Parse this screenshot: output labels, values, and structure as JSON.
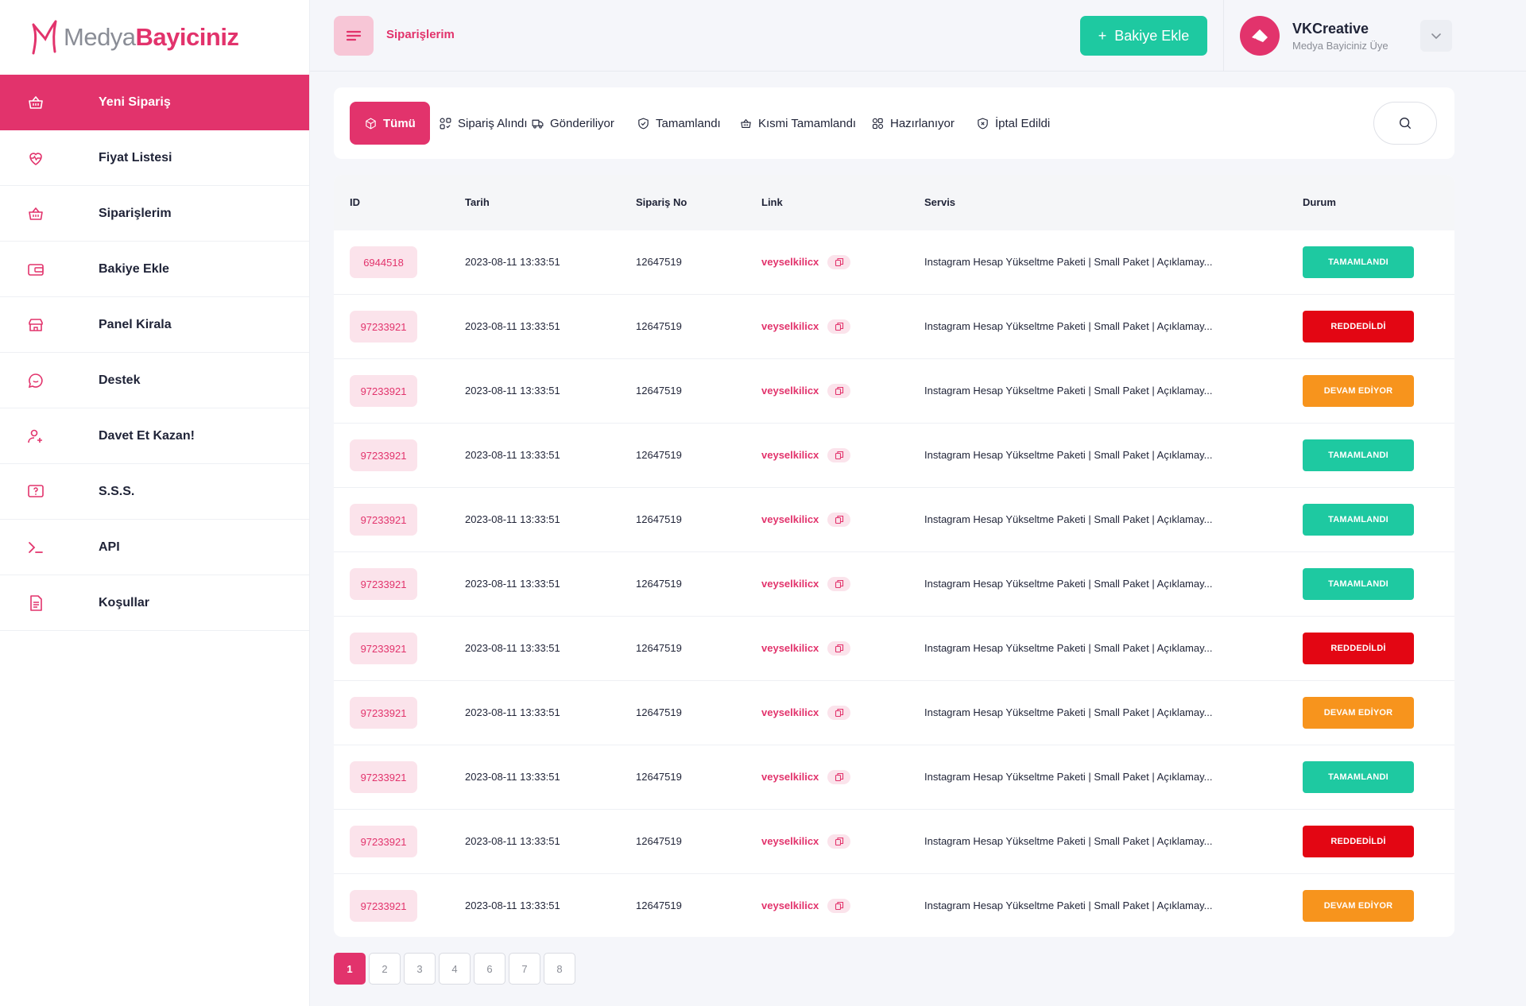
{
  "brand": {
    "light": "Medya",
    "bold": "Bayiciniz",
    "accent": "#e2336c"
  },
  "sidebar": {
    "items": [
      {
        "label": "Yeni Sipariş",
        "icon": "basket-icon",
        "active": true
      },
      {
        "label": "Fiyat Listesi",
        "icon": "heart-pulse-icon"
      },
      {
        "label": "Siparişlerim",
        "icon": "basket-icon"
      },
      {
        "label": "Bakiye Ekle",
        "icon": "wallet-icon"
      },
      {
        "label": "Panel Kirala",
        "icon": "store-icon"
      },
      {
        "label": "Destek",
        "icon": "chat-icon"
      },
      {
        "label": "Davet Et Kazan!",
        "icon": "user-add-icon"
      },
      {
        "label": "S.S.S.",
        "icon": "question-icon"
      },
      {
        "label": "API",
        "icon": "terminal-icon"
      },
      {
        "label": "Koşullar",
        "icon": "document-icon"
      }
    ]
  },
  "header": {
    "breadcrumb": "Siparişlerim",
    "add_balance_label": "Bakiye Ekle",
    "add_balance_plus": "+",
    "user": {
      "name": "VKCreative",
      "role": "Medya Bayiciniz Üye"
    }
  },
  "filters": [
    {
      "label": "Tümü",
      "icon": "box-icon",
      "active": true
    },
    {
      "label": "Sipariş Alındı",
      "icon": "received-icon"
    },
    {
      "label": "Gönderiliyor",
      "icon": "truck-icon"
    },
    {
      "label": "Tamamlandı",
      "icon": "check-shield-icon"
    },
    {
      "label": "Kısmi Tamamlandı",
      "icon": "basket-icon"
    },
    {
      "label": "Hazırlanıyor",
      "icon": "preparing-icon"
    },
    {
      "label": "İptal Edildi",
      "icon": "cancel-shield-icon"
    }
  ],
  "table": {
    "columns": [
      "ID",
      "Tarih",
      "Sipariş No",
      "Link",
      "Servis",
      "Durum"
    ],
    "rows": [
      {
        "id": "6944518",
        "date": "2023-08-11 13:33:51",
        "order_no": "12647519",
        "link": "veyselkilicx",
        "service": "Instagram Hesap Yükseltme Paketi | Small Paket | Açıklamay...",
        "status": "TAMAMLANDI",
        "status_color": "#1ec9a1"
      },
      {
        "id": "97233921",
        "date": "2023-08-11 13:33:51",
        "order_no": "12647519",
        "link": "veyselkilicx",
        "service": "Instagram Hesap Yükseltme Paketi | Small Paket | Açıklamay...",
        "status": "REDDEDİLDİ",
        "status_color": "#e30613"
      },
      {
        "id": "97233921",
        "date": "2023-08-11 13:33:51",
        "order_no": "12647519",
        "link": "veyselkilicx",
        "service": "Instagram Hesap Yükseltme Paketi | Small Paket | Açıklamay...",
        "status": "DEVAM EDİYOR",
        "status_color": "#f7941d"
      },
      {
        "id": "97233921",
        "date": "2023-08-11 13:33:51",
        "order_no": "12647519",
        "link": "veyselkilicx",
        "service": "Instagram Hesap Yükseltme Paketi | Small Paket | Açıklamay...",
        "status": "TAMAMLANDI",
        "status_color": "#1ec9a1"
      },
      {
        "id": "97233921",
        "date": "2023-08-11 13:33:51",
        "order_no": "12647519",
        "link": "veyselkilicx",
        "service": "Instagram Hesap Yükseltme Paketi | Small Paket | Açıklamay...",
        "status": "TAMAMLANDI",
        "status_color": "#1ec9a1"
      },
      {
        "id": "97233921",
        "date": "2023-08-11 13:33:51",
        "order_no": "12647519",
        "link": "veyselkilicx",
        "service": "Instagram Hesap Yükseltme Paketi | Small Paket | Açıklamay...",
        "status": "TAMAMLANDI",
        "status_color": "#1ec9a1"
      },
      {
        "id": "97233921",
        "date": "2023-08-11 13:33:51",
        "order_no": "12647519",
        "link": "veyselkilicx",
        "service": "Instagram Hesap Yükseltme Paketi | Small Paket | Açıklamay...",
        "status": "REDDEDİLDİ",
        "status_color": "#e30613"
      },
      {
        "id": "97233921",
        "date": "2023-08-11 13:33:51",
        "order_no": "12647519",
        "link": "veyselkilicx",
        "service": "Instagram Hesap Yükseltme Paketi | Small Paket | Açıklamay...",
        "status": "DEVAM EDİYOR",
        "status_color": "#f7941d"
      },
      {
        "id": "97233921",
        "date": "2023-08-11 13:33:51",
        "order_no": "12647519",
        "link": "veyselkilicx",
        "service": "Instagram Hesap Yükseltme Paketi | Small Paket | Açıklamay...",
        "status": "TAMAMLANDI",
        "status_color": "#1ec9a1"
      },
      {
        "id": "97233921",
        "date": "2023-08-11 13:33:51",
        "order_no": "12647519",
        "link": "veyselkilicx",
        "service": "Instagram Hesap Yükseltme Paketi | Small Paket | Açıklamay...",
        "status": "REDDEDİLDİ",
        "status_color": "#e30613"
      },
      {
        "id": "97233921",
        "date": "2023-08-11 13:33:51",
        "order_no": "12647519",
        "link": "veyselkilicx",
        "service": "Instagram Hesap Yükseltme Paketi | Small Paket | Açıklamay...",
        "status": "DEVAM EDİYOR",
        "status_color": "#f7941d"
      }
    ]
  },
  "pagination": {
    "pages": [
      "1",
      "2",
      "3",
      "4",
      "6",
      "7",
      "8"
    ],
    "current": "1"
  }
}
